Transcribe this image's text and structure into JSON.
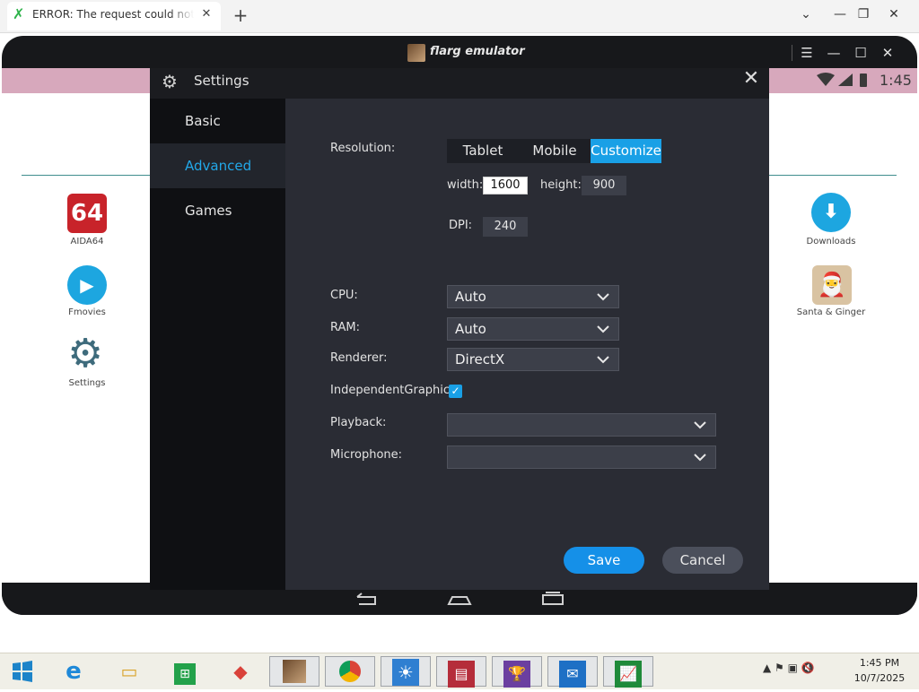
{
  "browser": {
    "tab_title": "ERROR: The request could not be satisfied",
    "tab_close": "✕",
    "new_tab": "+",
    "controls": {
      "minimize": "—",
      "restore": "❐",
      "close": "✕"
    }
  },
  "emulator": {
    "title": "flarg emulator",
    "controls": {
      "menu": "☰",
      "minimize": "—",
      "maximize": "☐",
      "close": "✕"
    },
    "status_time": "1:45",
    "home_apps_left": [
      {
        "label": "AIDA64",
        "icon": "aida64-icon",
        "glyph": "64",
        "color": "#c8232a"
      },
      {
        "label": "Fmovies",
        "icon": "play-icon",
        "glyph": "▶",
        "color": "#1da6e0"
      },
      {
        "label": "Settings",
        "icon": "gear-icon",
        "glyph": "⚙",
        "color": "#3e6b7c"
      }
    ],
    "home_apps_right": [
      {
        "label": "Downloads",
        "icon": "download-icon",
        "glyph": "⬇",
        "color": "#1da6e0"
      },
      {
        "label": "Santa & Ginger",
        "icon": "santa-ginger-icon",
        "glyph": "🎅",
        "color": "#b03b2a"
      }
    ]
  },
  "settings": {
    "title": "Settings",
    "close": "✕",
    "sidebar": [
      {
        "label": "Basic",
        "active": false
      },
      {
        "label": "Advanced",
        "active": true
      },
      {
        "label": "Games",
        "active": false
      }
    ],
    "resolution": {
      "label": "Resolution:",
      "options": [
        "Tablet",
        "Mobile",
        "Customize"
      ],
      "selected": "Customize",
      "width_label": "width:",
      "width_value": "1600",
      "height_label": "height:",
      "height_value": "900",
      "dpi_label": "DPI:",
      "dpi_value": "240"
    },
    "cpu": {
      "label": "CPU:",
      "value": "Auto"
    },
    "ram": {
      "label": "RAM:",
      "value": "Auto"
    },
    "renderer": {
      "label": "Renderer:",
      "value": "DirectX"
    },
    "independent_graphics": {
      "label": "IndependentGraphics:",
      "checked": true,
      "check_glyph": "✓"
    },
    "playback": {
      "label": "Playback:",
      "value": ""
    },
    "microphone": {
      "label": "Microphone:",
      "value": ""
    },
    "save_label": "Save",
    "cancel_label": "Cancel"
  },
  "taskbar": {
    "clock_time": "1:45 PM",
    "clock_date": "10/7/2025",
    "tray": "▲ ⚑ ▣ 🔇"
  },
  "colors": {
    "accent": "#19a0e6",
    "status_bar": "#d7a8bc",
    "dialog_bg": "#2a2c34",
    "sidebar_bg": "#0f1013"
  }
}
